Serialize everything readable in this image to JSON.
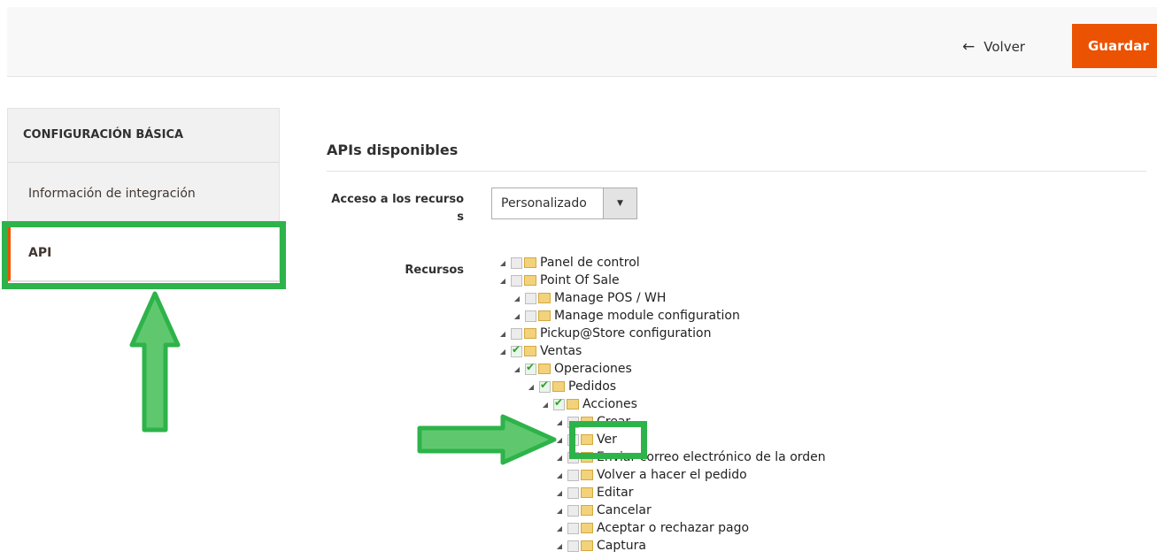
{
  "header": {
    "back_label": "Volver",
    "save_label": "Guardar",
    "accent": "#eb5202"
  },
  "sidebar": {
    "section_title": "CONFIGURACIÓN BÁSICA",
    "items": [
      {
        "label": "Información de integración",
        "active": false
      },
      {
        "label": "API",
        "active": true
      }
    ]
  },
  "main": {
    "section_title": "APIs disponibles",
    "access_label_line1": "Acceso a los recurso",
    "access_label_line2": "s",
    "access_value": "Personalizado",
    "resources_label": "Recursos"
  },
  "tree": [
    {
      "label": "Panel de control",
      "level": 0,
      "checked": false
    },
    {
      "label": "Point Of Sale",
      "level": 0,
      "checked": false
    },
    {
      "label": "Manage POS / WH",
      "level": 1,
      "checked": false
    },
    {
      "label": "Manage module configuration",
      "level": 1,
      "checked": false
    },
    {
      "label": "Pickup@Store configuration",
      "level": 0,
      "checked": false
    },
    {
      "label": "Ventas",
      "level": 0,
      "checked": true
    },
    {
      "label": "Operaciones",
      "level": 1,
      "checked": true
    },
    {
      "label": "Pedidos",
      "level": 2,
      "checked": true
    },
    {
      "label": "Acciones",
      "level": 3,
      "checked": true
    },
    {
      "label": "Crear",
      "level": 4,
      "checked": false
    },
    {
      "label": "Ver",
      "level": 4,
      "checked": true
    },
    {
      "label": "Enviar correo electrónico de la orden",
      "level": 4,
      "checked": false
    },
    {
      "label": "Volver a hacer el pedido",
      "level": 4,
      "checked": false
    },
    {
      "label": "Editar",
      "level": 4,
      "checked": false
    },
    {
      "label": "Cancelar",
      "level": 4,
      "checked": false
    },
    {
      "label": "Aceptar o rechazar pago",
      "level": 4,
      "checked": false
    },
    {
      "label": "Captura",
      "level": 4,
      "checked": false
    }
  ],
  "annotation_color": "#2db34a"
}
